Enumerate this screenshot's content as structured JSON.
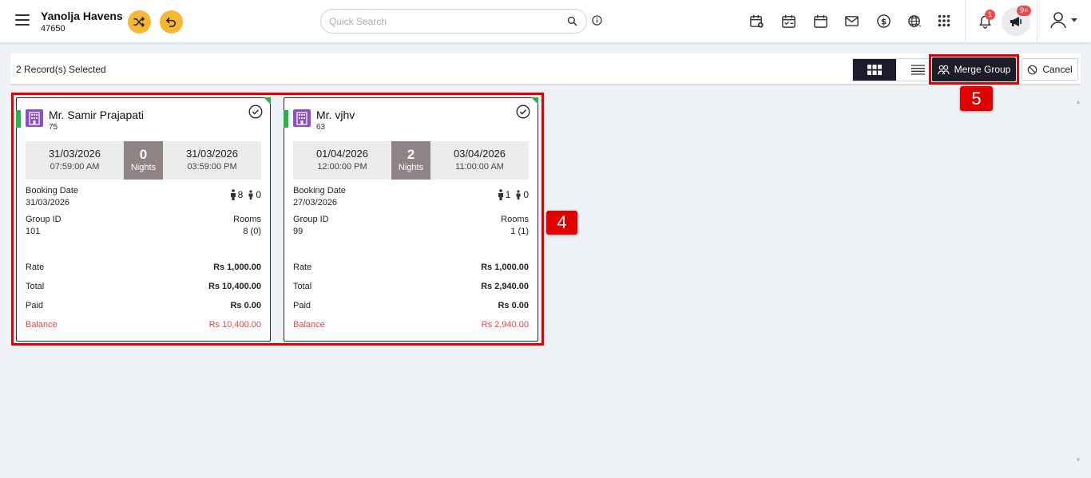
{
  "header": {
    "hotel_name": "Yanolja Havens",
    "hotel_code": "47650",
    "search_placeholder": "Quick Search",
    "notification_count": "1",
    "announcement_count": "9+",
    "accent_color": "#f7b731"
  },
  "toolbar": {
    "selected_text": "2 Record(s) Selected",
    "merge_label": "Merge Group",
    "cancel_label": "Cancel"
  },
  "annotations": {
    "callout_cards": "4",
    "callout_merge": "5"
  },
  "labels": {
    "nights": "Nights",
    "booking_date": "Booking Date",
    "group_id": "Group ID",
    "rooms": "Rooms",
    "rate": "Rate",
    "total": "Total",
    "paid": "Paid",
    "balance": "Balance"
  },
  "cards": [
    {
      "name": "Mr. Samir Prajapati",
      "id": "75",
      "arrival_date": "31/03/2026",
      "arrival_time": "07:59:00 AM",
      "nights": "0",
      "departure_date": "31/03/2026",
      "departure_time": "03:59:00 PM",
      "booking_date": "31/03/2026",
      "adults": "8",
      "children": "0",
      "group_id": "101",
      "rooms": "8 (0)",
      "rate": "Rs 1,000.00",
      "total": "Rs 10,400.00",
      "paid": "Rs 0.00",
      "balance": "Rs 10,400.00"
    },
    {
      "name": "Mr. vjhv",
      "id": "63",
      "arrival_date": "01/04/2026",
      "arrival_time": "12:00:00 PM",
      "nights": "2",
      "departure_date": "03/04/2026",
      "departure_time": "11:00:00 AM",
      "booking_date": "27/03/2026",
      "adults": "1",
      "children": "0",
      "group_id": "99",
      "rooms": "1 (1)",
      "rate": "Rs 1,000.00",
      "total": "Rs 2,940.00",
      "paid": "Rs 0.00",
      "balance": "Rs 2,940.00"
    }
  ]
}
